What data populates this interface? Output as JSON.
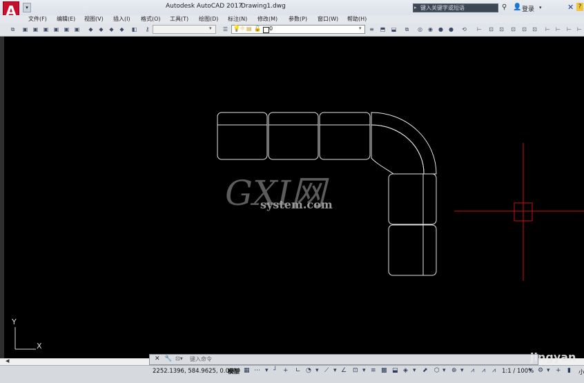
{
  "app": {
    "logo_letter": "A",
    "title": "Autodesk AutoCAD 2017",
    "document": "Drawing1.dwg",
    "search_placeholder": "键入关键字或短语",
    "login_label": "登录"
  },
  "menu": [
    "文件(F)",
    "编辑(E)",
    "视图(V)",
    "插入(I)",
    "格式(O)",
    "工具(T)",
    "绘图(D)",
    "标注(N)",
    "修改(M)",
    "参数(P)",
    "窗口(W)",
    "帮助(H)"
  ],
  "layer": {
    "current": "0"
  },
  "canvas": {
    "ucs_y": "Y",
    "ucs_x": "X",
    "crosshair_color": "#cc1111",
    "line_color": "#e6e6e6"
  },
  "command": {
    "placeholder": "键入命令"
  },
  "status": {
    "coordinates": "2252.1396, 584.9625, 0.0000",
    "model": "模型",
    "scale": "1:1 / 100%",
    "small": "小"
  },
  "watermarks": {
    "gx": "GXI网",
    "site": "system.com",
    "jingyan": "jingyan"
  }
}
